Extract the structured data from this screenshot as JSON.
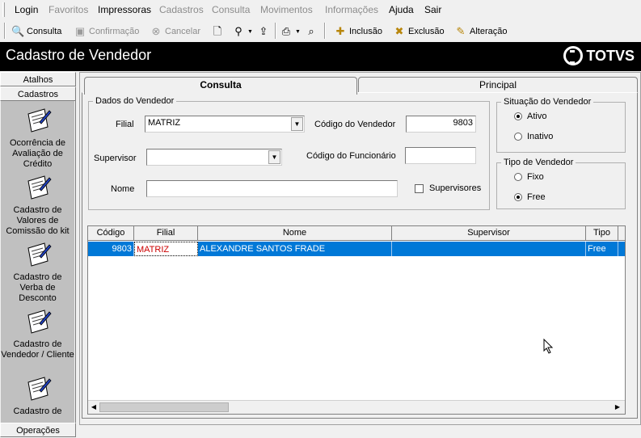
{
  "menu": {
    "items": [
      {
        "label": "Login",
        "disabled": false
      },
      {
        "label": "Favoritos",
        "disabled": true
      },
      {
        "label": "Impressoras",
        "disabled": false
      },
      {
        "label": "Cadastros",
        "disabled": true
      },
      {
        "label": "Consulta",
        "disabled": true
      },
      {
        "label": "Movimentos",
        "disabled": true
      },
      {
        "label": "Informações",
        "disabled": true
      },
      {
        "label": "Ajuda",
        "disabled": false
      },
      {
        "label": "Sair",
        "disabled": false
      }
    ]
  },
  "toolbar": {
    "consulta": "Consulta",
    "confirmacao": "Confirmação",
    "cancelar": "Cancelar",
    "inclusao": "Inclusão",
    "exclusao": "Exclusão",
    "alteracao": "Alteração"
  },
  "window": {
    "title": "Cadastro de Vendedor",
    "logo": "TOTVS"
  },
  "sidebar": {
    "atalhos": "Atalhos",
    "cadastros": "Cadastros",
    "operacoes": "Operações",
    "items": [
      {
        "label": "Ocorrência de Avaliação de Crédito",
        "icon": "document-edit-icon"
      },
      {
        "label": "Cadastro de Valores de Comissão do kit",
        "icon": "document-edit-icon"
      },
      {
        "label": "Cadastro de Verba de Desconto",
        "icon": "document-edit-icon"
      },
      {
        "label": "Cadastro de Vendedor / Cliente",
        "icon": "document-edit-icon"
      },
      {
        "label": "Cadastro de",
        "icon": "document-edit-icon"
      }
    ]
  },
  "tabs": {
    "consulta": "Consulta",
    "principal": "Principal"
  },
  "dados": {
    "legend": "Dados do Vendedor",
    "filial_label": "Filial",
    "filial_value": "MATRIZ",
    "codigo_vendedor_label": "Código do Vendedor",
    "codigo_vendedor_value": "9803",
    "supervisor_label": "Supervisor",
    "supervisor_value": "",
    "codigo_funcionario_label": "Código do Funcionário",
    "codigo_funcionario_value": "",
    "nome_label": "Nome",
    "nome_value": "",
    "supervisores_label": "Supervisores",
    "supervisores_checked": false
  },
  "situacao": {
    "legend": "Situação do Vendedor",
    "ativo": "Ativo",
    "inativo": "Inativo",
    "selected": "ativo"
  },
  "tipo": {
    "legend": "Tipo de Vendedor",
    "fixo": "Fixo",
    "free": "Free",
    "selected": "free"
  },
  "grid": {
    "columns": [
      "Código",
      "Filial",
      "Nome",
      "Supervisor",
      "Tipo"
    ],
    "rows": [
      {
        "codigo": "9803",
        "filial": "MATRIZ",
        "nome": "ALEXANDRE SANTOS FRADE",
        "supervisor": "",
        "tipo": "Free"
      }
    ]
  },
  "colors": {
    "title_bg": "#000000",
    "selection": "#0078d7",
    "filial_highlight": "#cc0000",
    "sidebar_panel": "#c0c0c0"
  }
}
